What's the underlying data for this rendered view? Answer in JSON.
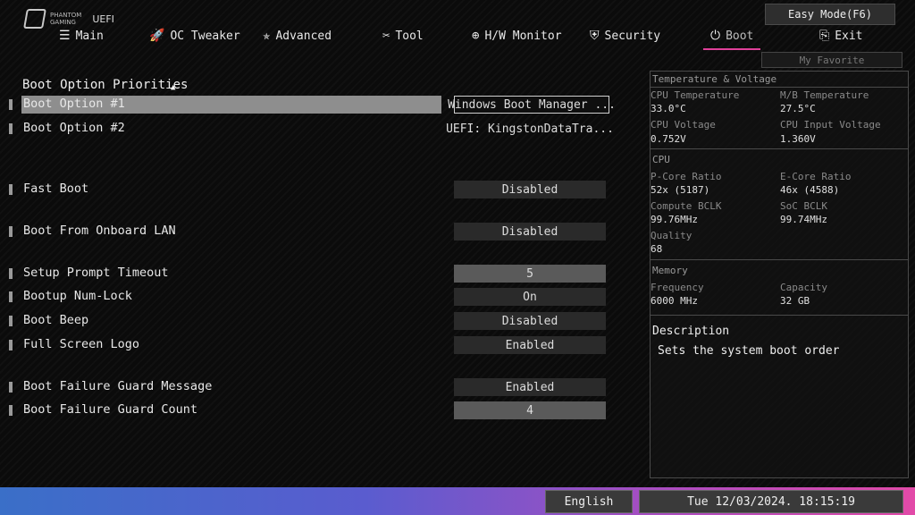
{
  "app": {
    "brand_line1": "PHANTOM",
    "brand_line2": "GAMING",
    "title": "UEFI"
  },
  "easy_mode_label": "Easy Mode(F6)",
  "nav": {
    "tabs": [
      {
        "label": "Main",
        "icon": "menu-icon"
      },
      {
        "label": "OC Tweaker",
        "icon": "rocket-icon"
      },
      {
        "label": "Advanced",
        "icon": "star-icon"
      },
      {
        "label": "Tool",
        "icon": "tools-icon"
      },
      {
        "label": "H/W Monitor",
        "icon": "crosshair-icon"
      },
      {
        "label": "Security",
        "icon": "shield-icon"
      },
      {
        "label": "Boot",
        "icon": "power-icon",
        "active": true
      },
      {
        "label": "Exit",
        "icon": "exit-door-icon"
      }
    ],
    "favorite_label": "My Favorite"
  },
  "main": {
    "section_title": "Boot Option Priorities",
    "options": [
      {
        "label": "Boot Option #1",
        "value": "Windows Boot Manager ..."
      },
      {
        "label": "Boot Option #2",
        "value": "UEFI: KingstonDataTra..."
      },
      {
        "label": "Fast Boot",
        "value": "Disabled"
      },
      {
        "label": "Boot From Onboard LAN",
        "value": "Disabled"
      },
      {
        "label": "Setup Prompt Timeout",
        "value": "5"
      },
      {
        "label": "Bootup Num-Lock",
        "value": "On"
      },
      {
        "label": "Boot Beep",
        "value": "Disabled"
      },
      {
        "label": "Full Screen Logo",
        "value": "Enabled"
      },
      {
        "label": "Boot Failure Guard Message",
        "value": "Enabled"
      },
      {
        "label": "Boot Failure Guard Count",
        "value": "4"
      }
    ]
  },
  "panel": {
    "temp_title": "Temperature & Voltage",
    "cpu_temp_label": "CPU Temperature",
    "cpu_temp": "33.0°C",
    "mb_temp_label": "M/B Temperature",
    "mb_temp": "27.5°C",
    "cpu_volt_label": "CPU Voltage",
    "cpu_volt": "0.752V",
    "cpu_in_volt_label": "CPU Input Voltage",
    "cpu_in_volt": "1.360V",
    "cpu_title": "CPU",
    "pcore_label": "P-Core Ratio",
    "pcore": "52x (5187)",
    "ecore_label": "E-Core Ratio",
    "ecore": "46x (4588)",
    "bclk_label": "Compute BCLK",
    "bclk": "99.76MHz",
    "soc_label": "SoC BCLK",
    "soc": "99.74MHz",
    "quality_label": "Quality",
    "quality": "68",
    "mem_title": "Memory",
    "freq_label": "Frequency",
    "freq": "6000 MHz",
    "cap_label": "Capacity",
    "cap": "32 GB",
    "desc_title": "Description",
    "desc_text": "Sets the system boot order"
  },
  "footer": {
    "language": "English",
    "datetime": "Tue 12/03/2024. 18:15:19"
  },
  "colors": {
    "accent": "#e0409a",
    "selected_row": "#8e8e8e",
    "bottom_left": "#3a6fc8",
    "bottom_right": "#e24aa8"
  }
}
